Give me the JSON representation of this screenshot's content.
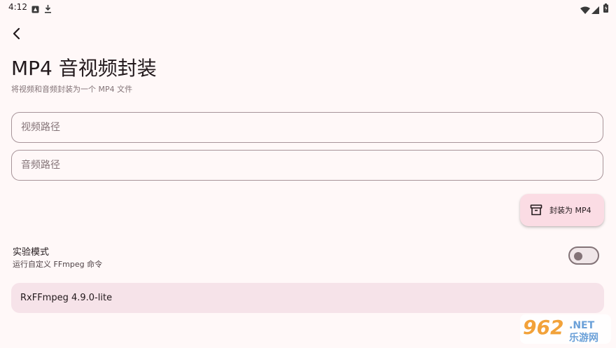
{
  "status_bar": {
    "time": "4:12"
  },
  "header": {
    "title": "MP4 音视频封装",
    "subtitle": "将视频和音频封装为一个 MP4 文件"
  },
  "form": {
    "video_path": {
      "value": "",
      "placeholder": "视频路径"
    },
    "audio_path": {
      "value": "",
      "placeholder": "音频路径"
    }
  },
  "fab": {
    "label": "封装为 MP4",
    "icon": "archive-icon"
  },
  "experimental": {
    "title": "实验模式",
    "subtitle": "运行自定义 FFmpeg 命令",
    "enabled": false
  },
  "version": {
    "text": "RxFFmpeg 4.9.0-lite"
  },
  "watermark": {
    "brand": "962",
    "suffix": ".NET",
    "caption": "乐游网"
  },
  "colors": {
    "background": "#fff8f8",
    "fab_background": "#fbdce4",
    "card_background": "#f6e3e9",
    "outline": "#a79499",
    "text_primary": "#22191c",
    "text_secondary": "#837377"
  }
}
